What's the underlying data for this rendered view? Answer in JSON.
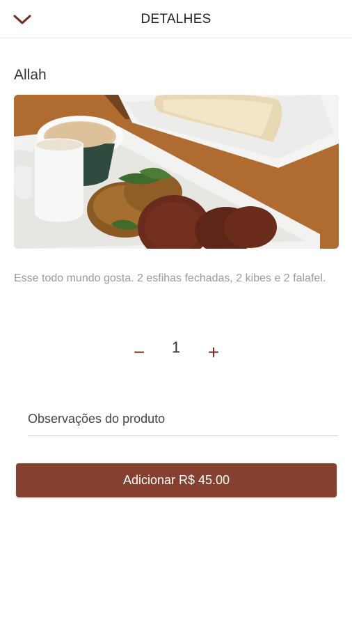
{
  "header": {
    "title": "DETALHES",
    "back_icon": "chevron-down-icon",
    "accent_color": "#86402f"
  },
  "product": {
    "name": "Allah",
    "image": "food-photo",
    "description": "Esse todo mundo gosta. 2 esfihas fechadas, 2 kibes e 2 falafel."
  },
  "quantity": {
    "minus_label": "−",
    "value": "1",
    "plus_label": "+"
  },
  "notes": {
    "placeholder": "Observações do produto",
    "value": ""
  },
  "add_button": {
    "label": "Adicionar R$ 45.00"
  }
}
